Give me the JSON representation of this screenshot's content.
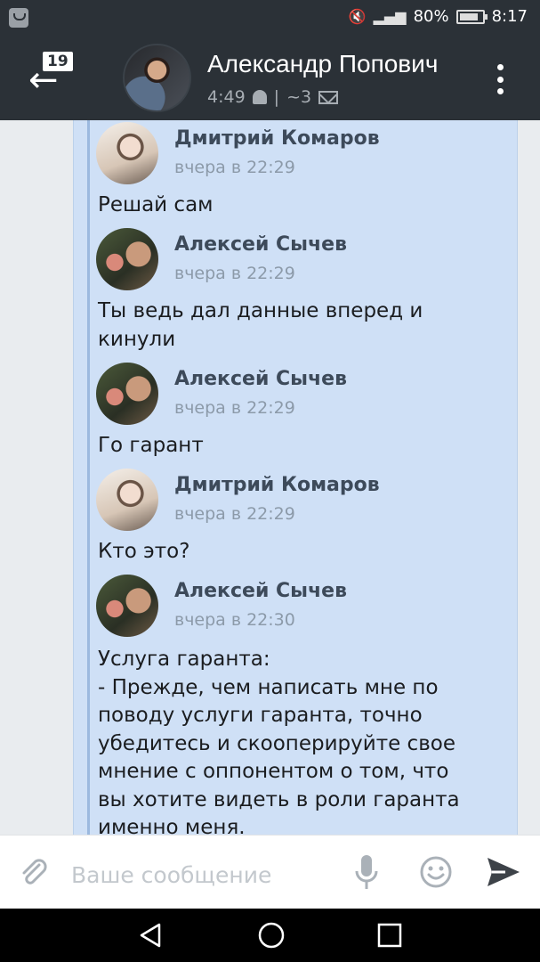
{
  "status_bar": {
    "battery": "80%",
    "time": "8:17"
  },
  "header": {
    "badge": "19",
    "title": "Александр Попович",
    "subtitle_time": "4:49",
    "subtitle_separator": "|",
    "subtitle_count": "~3"
  },
  "messages": [
    {
      "author": "Дмитрий Комаров",
      "time": "вчера в 22:29",
      "text": "Решай сам",
      "avatar": "dmitry"
    },
    {
      "author": "Алексей Сычев",
      "time": "вчера в 22:29",
      "text": "Ты ведь дал данные вперед и\nкинули",
      "avatar": "alexey"
    },
    {
      "author": "Алексей Сычев",
      "time": "вчера в 22:29",
      "text": "Го гарант",
      "avatar": "alexey"
    },
    {
      "author": "Дмитрий Комаров",
      "time": "вчера в 22:29",
      "text": "Кто это?",
      "avatar": "dmitry"
    },
    {
      "author": "Алексей Сычев",
      "time": "вчера в 22:30",
      "text": "Услуга гаранта:\n- Прежде, чем написать мне по\nповоду услуги гаранта, точно\nубедитесь и скооперируйте свое\nмнение с оппонентом о том, что\nвы хотите видеть в роли гаранта\nименно меня.",
      "avatar": "alexey"
    }
  ],
  "input": {
    "placeholder": "Ваше сообщение"
  },
  "icons": {
    "back": "back-arrow-icon",
    "menu": "more-vertical-icon",
    "attach": "paperclip-icon",
    "mic": "microphone-icon",
    "emoji": "smile-icon",
    "send": "send-icon"
  },
  "colors": {
    "header_bg": "#2b3137",
    "bubble_bg": "#cfe0f6",
    "forward_line": "#9cb9df"
  }
}
